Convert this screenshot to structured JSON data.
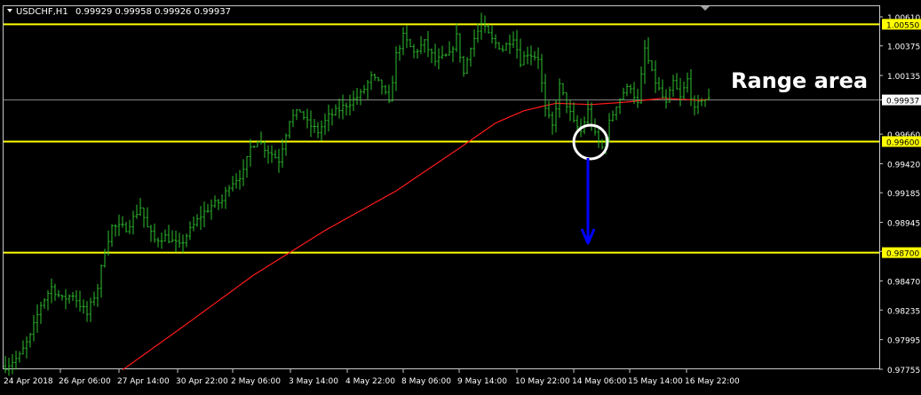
{
  "header": {
    "symbol_label": "USDCHF,H1",
    "ohlc": "0.99929 0.99958 0.99926 0.99937"
  },
  "annotation": "Range area",
  "colors": {
    "background": "#000000",
    "frame": "#c8c8c8",
    "bars": "#2ec02e",
    "moving_average": "#ff1a1a",
    "level_lines": "#ffff00",
    "bid_line": "#8a8a8a",
    "arrow": "#0000ff",
    "circle": "#ffffff",
    "text": "#ffffff"
  },
  "chart_data": {
    "type": "ohlc-bar",
    "symbol": "USDCHF",
    "timeframe": "H1",
    "ylim": [
      0.97755,
      1.0061
    ],
    "y_ticks": [
      "1.00610",
      "1.00375",
      "1.00135",
      "0.99937",
      "0.99660",
      "0.99420",
      "0.99185",
      "0.98945",
      "0.98710",
      "0.98470",
      "0.98235",
      "0.97995",
      "0.97755"
    ],
    "x_ticks": [
      "24 Apr 2018",
      "26 Apr 06:00",
      "27 Apr 14:00",
      "30 Apr 22:00",
      "2 May 06:00",
      "3 May 14:00",
      "4 May 22:00",
      "8 May 06:00",
      "9 May 14:00",
      "10 May 22:00",
      "14 May 06:00",
      "15 May 14:00",
      "16 May 22:00"
    ],
    "horizontal_levels": [
      {
        "price": 1.0055,
        "label": "1.00550"
      },
      {
        "price": 0.996,
        "label": "0.99600"
      },
      {
        "price": 0.987,
        "label": "0.98700"
      }
    ],
    "current_price": {
      "price": 0.99937,
      "label": "0.99937"
    },
    "close_anchors": [
      [
        0,
        0.9778
      ],
      [
        4,
        0.9786
      ],
      [
        7,
        0.9802
      ],
      [
        10,
        0.9828
      ],
      [
        13,
        0.9842
      ],
      [
        16,
        0.9832
      ],
      [
        19,
        0.9836
      ],
      [
        21,
        0.9828
      ],
      [
        23,
        0.982
      ],
      [
        26,
        0.9842
      ],
      [
        28,
        0.9872
      ],
      [
        30,
        0.9891
      ],
      [
        34,
        0.989
      ],
      [
        36,
        0.9898
      ],
      [
        38,
        0.9907
      ],
      [
        40,
        0.989
      ],
      [
        42,
        0.988
      ],
      [
        45,
        0.9883
      ],
      [
        49,
        0.9875
      ],
      [
        51,
        0.9884
      ],
      [
        55,
        0.99
      ],
      [
        58,
        0.9908
      ],
      [
        61,
        0.9912
      ],
      [
        63,
        0.9925
      ],
      [
        67,
        0.9935
      ],
      [
        69,
        0.9955
      ],
      [
        71,
        0.9962
      ],
      [
        73,
        0.9955
      ],
      [
        75,
        0.995
      ],
      [
        77,
        0.9945
      ],
      [
        80,
        0.9978
      ],
      [
        83,
        0.9985
      ],
      [
        85,
        0.9975
      ],
      [
        88,
        0.9968
      ],
      [
        91,
        0.998
      ],
      [
        96,
        0.999
      ],
      [
        100,
        0.9998
      ],
      [
        103,
        1.0012
      ],
      [
        106,
        1.0005
      ],
      [
        108,
        0.999
      ],
      [
        110,
        1.003
      ],
      [
        112,
        1.0045
      ],
      [
        115,
        1.0032
      ],
      [
        118,
        1.004
      ],
      [
        121,
        1.0025
      ],
      [
        125,
        1.003
      ],
      [
        127,
        1.0045
      ],
      [
        129,
        1.0015
      ],
      [
        131,
        1.0038
      ],
      [
        134,
        1.0055
      ],
      [
        137,
        1.0042
      ],
      [
        140,
        1.0035
      ],
      [
        143,
        1.0045
      ],
      [
        145,
        1.0025
      ],
      [
        147,
        1.0032
      ],
      [
        150,
        1.0028
      ],
      [
        152,
        0.9985
      ],
      [
        154,
        0.9972
      ],
      [
        156,
        1.0005
      ],
      [
        158,
        0.999
      ],
      [
        160,
        0.9975
      ],
      [
        162,
        0.9968
      ],
      [
        164,
        0.9985
      ],
      [
        166,
        0.9965
      ],
      [
        168,
        0.9955
      ],
      [
        170,
        0.9975
      ],
      [
        172,
        0.999
      ],
      [
        174,
        1.0
      ],
      [
        176,
        1.0005
      ],
      [
        178,
        0.999
      ],
      [
        180,
        1.0035
      ],
      [
        182,
        1.0015
      ],
      [
        184,
        1.0002
      ],
      [
        186,
        0.999
      ],
      [
        188,
        1.0008
      ],
      [
        190,
        0.9995
      ],
      [
        192,
        1.001
      ],
      [
        194,
        0.9985
      ],
      [
        196,
        0.9995
      ],
      [
        198,
        0.99937
      ]
    ],
    "moving_average_anchors": [
      [
        33,
        0.9775
      ],
      [
        50,
        0.981
      ],
      [
        70,
        0.9852
      ],
      [
        90,
        0.9888
      ],
      [
        110,
        0.992
      ],
      [
        128,
        0.9955
      ],
      [
        138,
        0.9975
      ],
      [
        146,
        0.9985
      ],
      [
        155,
        0.9991
      ],
      [
        165,
        0.999
      ],
      [
        175,
        0.9992
      ],
      [
        185,
        0.9995
      ],
      [
        195,
        0.99935
      ],
      [
        198,
        0.9994
      ]
    ]
  }
}
